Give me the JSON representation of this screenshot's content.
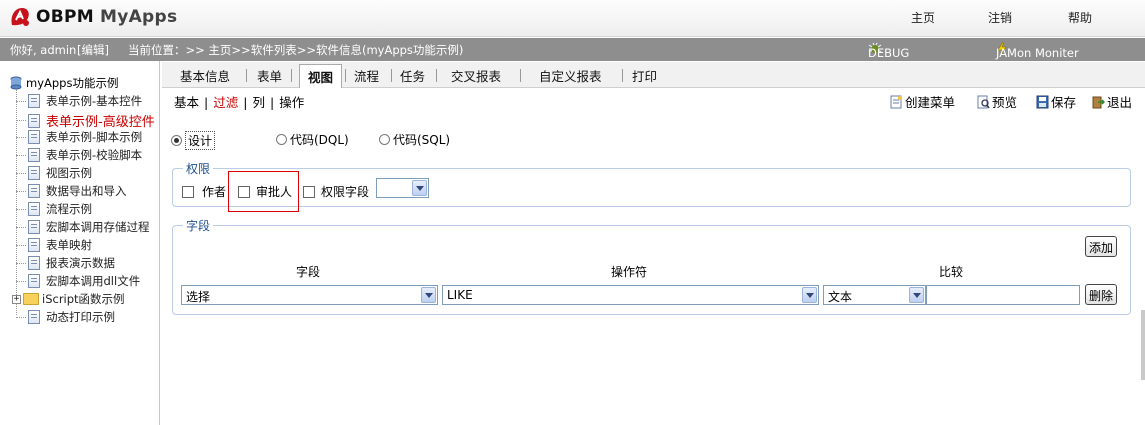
{
  "app": {
    "logo_text": "OBPM",
    "logo_sub": "MyApps"
  },
  "topnav": {
    "home": "主页",
    "logout": "注销",
    "help": "帮助"
  },
  "statusbar": {
    "greeting": "你好, admin",
    "edit": "[编辑]",
    "location": "当前位置：>> 主页>>软件列表>>软件信息(myApps功能示例)",
    "debug": "DEBUG",
    "jamon": "JAMon Moniter"
  },
  "sidebar": {
    "root": "myApps功能示例",
    "items": [
      {
        "label": "表单示例-基本控件"
      },
      {
        "label": "表单示例-高级控件",
        "active": true
      },
      {
        "label": "表单示例-脚本示例"
      },
      {
        "label": "表单示例-校验脚本"
      },
      {
        "label": "视图示例"
      },
      {
        "label": "数据导出和导入"
      },
      {
        "label": "流程示例"
      },
      {
        "label": "宏脚本调用存储过程"
      },
      {
        "label": "表单映射"
      },
      {
        "label": "报表演示数据"
      },
      {
        "label": "宏脚本调用dll文件"
      },
      {
        "label": "iScript函数示例",
        "folder": true
      },
      {
        "label": "动态打印示例"
      }
    ]
  },
  "tabs": [
    "基本信息",
    "表单",
    "视图",
    "流程",
    "任务",
    "交叉报表",
    "自定义报表",
    "打印"
  ],
  "active_tab": "视图",
  "subtabs": {
    "basic": "基本",
    "filter": "过滤",
    "column": "列",
    "operation": "操作",
    "separator": "|"
  },
  "toolbar": {
    "create_menu": "创建菜单",
    "preview": "预览",
    "save": "保存",
    "exit": "退出"
  },
  "mode": {
    "design": "设计",
    "dql": "代码(DQL)",
    "sql": "代码(SQL)",
    "selected": "design"
  },
  "permission": {
    "legend": "权限",
    "author": "作者",
    "approver": "审批人",
    "perm_field": "权限字段",
    "perm_field_value": ""
  },
  "fields": {
    "legend": "字段",
    "add_button": "添加",
    "delete_button": "删除",
    "col_field": "字段",
    "col_operator": "操作符",
    "col_compare": "比较",
    "field_value": "选择",
    "operator_value": "LIKE",
    "compare_type_value": "文本",
    "compare_input_value": ""
  },
  "colors": {
    "status_bg": "#8e8e8e",
    "active_red": "#cc0000",
    "legend_blue": "#1f4f8f",
    "fieldset_border": "#b9cde4"
  }
}
